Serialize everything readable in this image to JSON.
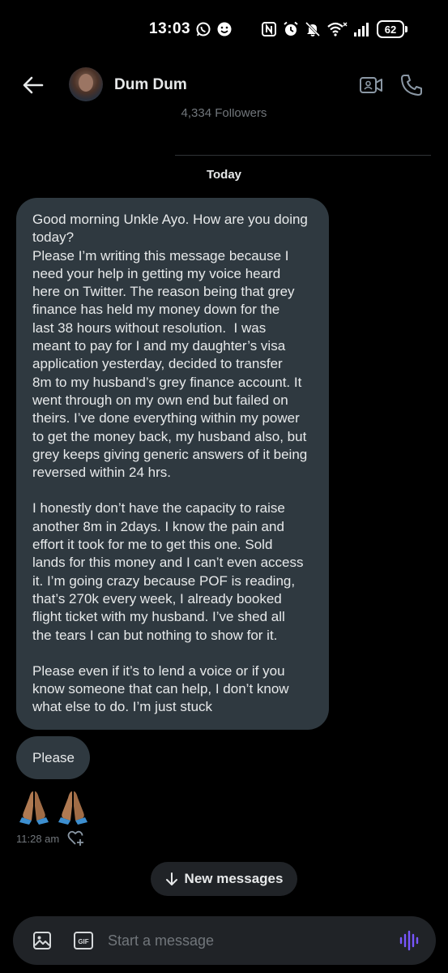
{
  "status_bar": {
    "time": "13:03",
    "battery": "62",
    "icons": [
      "whatsapp-icon",
      "emoji-face-icon",
      "nfc-icon",
      "alarm-icon",
      "mute-icon",
      "wifi-icon",
      "signal-icon",
      "battery-icon"
    ]
  },
  "header": {
    "contact_name": "Dum Dum",
    "followers": "4,334 Followers",
    "icons": [
      "back-arrow-icon",
      "video-call-icon",
      "phone-call-icon"
    ]
  },
  "conversation": {
    "date_label": "Today",
    "main_message_paragraphs": [
      "Good morning Unkle Ayo. How are you doing\ntoday?\nPlease I’m writing this message because I\nneed your help in getting my voice heard\nhere on Twitter. The reason being that grey\nfinance has held my money down for the\nlast 38 hours without resolution.  I was\nmeant to pay for I and my daughter’s visa\napplication yesterday, decided to transfer\n8m to my husband’s grey finance account. It\nwent through on my own end but failed on\ntheirs. I’ve done everything within my power\nto get the money back, my husband also, but\ngrey keeps giving generic answers of it being\nreversed within 24 hrs.",
      "I honestly don’t have the capacity to raise\nanother 8m in 2days. I know the pain and\neffort it took for me to get this one. Sold\nlands for this money and I can’t even access\nit. I’m going crazy because POF is reading,\nthat’s 270k every week, I already booked\nflight ticket with my husband. I’ve shed all\nthe tears I can but nothing to show for it.",
      "Please even if it’s to lend a voice or if you\nknow someone that can help, I don’t know\nwhat else to do. I’m just stuck"
    ],
    "please_message": "Please",
    "emoji_message": "🙏🏽🙏🏽",
    "timestamp": "11:28 am"
  },
  "new_messages_label": "New messages",
  "composer": {
    "placeholder": "Start a message",
    "gif_label": "GIF",
    "accent_color": "#7856ff"
  }
}
